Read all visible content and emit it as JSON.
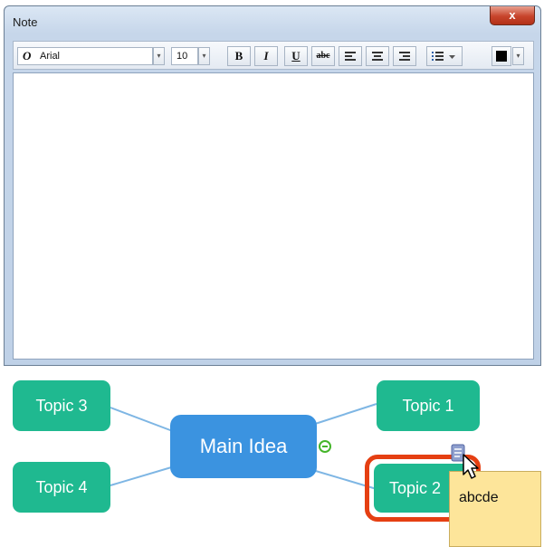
{
  "window": {
    "title": "Note",
    "close_glyph": "x"
  },
  "toolbar": {
    "font_icon": "O",
    "font_name": "Arial",
    "font_size": "10",
    "bold": "B",
    "italic": "I",
    "underline": "U",
    "strikethrough": "abc"
  },
  "mindmap": {
    "main": "Main Idea",
    "topics": [
      "Topic 1",
      "Topic 2",
      "Topic 3",
      "Topic 4"
    ],
    "note_tooltip": "abcde",
    "colors": {
      "main": "#3b93e0",
      "topic": "#1fb990",
      "selection": "#e53f12",
      "tooltip": "#fde59a",
      "connector": "#7eb6e4"
    }
  }
}
